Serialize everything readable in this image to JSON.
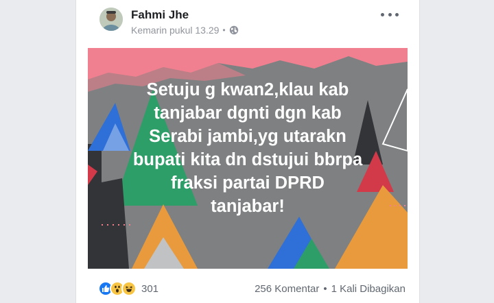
{
  "post": {
    "author": "Fahmi Jhe",
    "timestamp": "Kemarin pukul 13.29",
    "separator": "•",
    "privacy_icon": "globe-icon",
    "more_icon": "more-options-icon",
    "text_lines": [
      "Setuju g kwan2,klau kab",
      "tanjabar dgnti dgn kab",
      "Serabi jambi,yg utarakn",
      "bupati kita dn dstujui bbrpa",
      "fraksi partai DPRD",
      "tanjabar!"
    ],
    "background_colors": {
      "gray": "#7e8082",
      "pink": "#f0808f",
      "green": "#2e9e68",
      "blue": "#2f6fd8",
      "orange": "#e89a3c",
      "red": "#d23a4a",
      "dark": "#333438"
    }
  },
  "footer": {
    "reactions": [
      "like-icon",
      "wow-icon",
      "haha-icon"
    ],
    "reaction_count": "301",
    "comments": "256 Komentar",
    "separator": "•",
    "shares": "1 Kali Dibagikan"
  },
  "colors": {
    "like_blue": "#1877f2",
    "emoji_yellow": "#f7c443",
    "text_muted": "#606770",
    "text_dark": "#1c1e21"
  }
}
